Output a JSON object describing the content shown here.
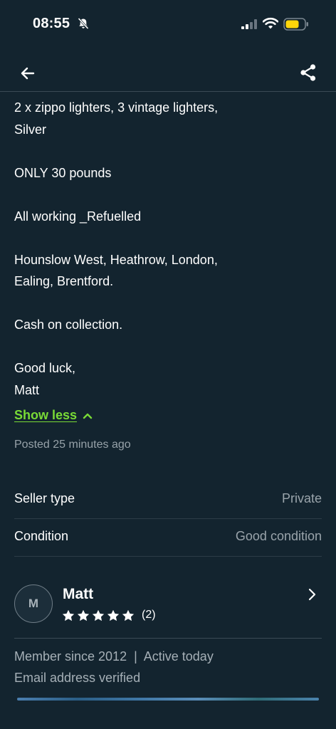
{
  "status_bar": {
    "time": "08:55"
  },
  "description": {
    "lines": [
      "2 x zippo lighters, 3 vintage lighters,",
      "Silver",
      "",
      "ONLY 30 pounds",
      "",
      "All working _Refuelled",
      "",
      "Hounslow West, Heathrow, London,",
      "Ealing, Brentford.",
      "",
      "Cash on collection.",
      "",
      "Good luck,",
      "Matt"
    ],
    "show_less_label": "Show less",
    "posted": "Posted 25 minutes ago"
  },
  "details": [
    {
      "label": "Seller type",
      "value": "Private"
    },
    {
      "label": "Condition",
      "value": "Good condition"
    }
  ],
  "seller": {
    "initial": "M",
    "name": "Matt",
    "rating": 5,
    "review_count": "(2)",
    "member_info": "Member since 2012  |  Active today",
    "verification": "Email address verified"
  },
  "colors": {
    "background": "#13242f",
    "accent": "#79db36",
    "muted_text": "#97a2a9",
    "battery": "#ffd60a"
  }
}
